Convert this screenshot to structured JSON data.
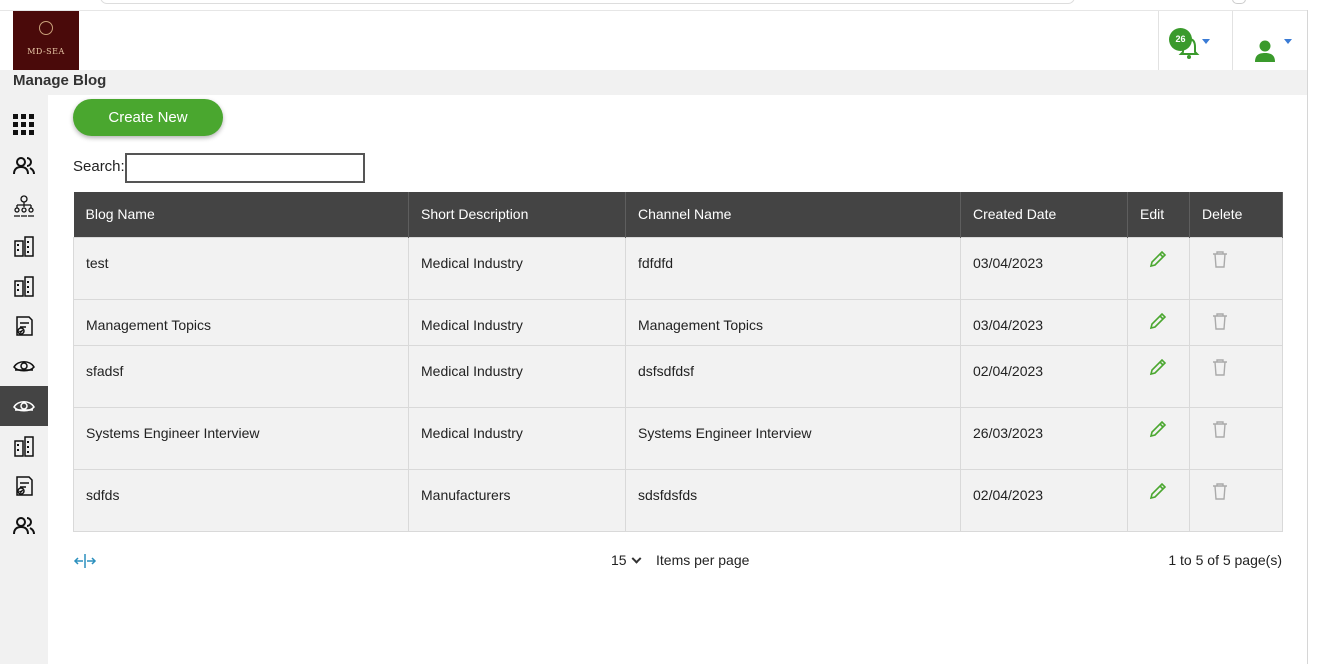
{
  "header": {
    "logo_text": "MD-SEA",
    "notification_count": "26"
  },
  "page": {
    "title": "Manage Blog"
  },
  "toolbar": {
    "create_label": "Create New"
  },
  "search": {
    "label": "Search:",
    "value": ""
  },
  "table": {
    "headers": [
      "Blog Name",
      "Short Description",
      "Channel Name",
      "Created Date",
      "Edit",
      "Delete"
    ],
    "rows": [
      {
        "blog_name": "test",
        "short_description": "Medical Industry",
        "channel_name": "fdfdfd",
        "created_date": "03/04/2023"
      },
      {
        "blog_name": "Management Topics",
        "short_description": "Medical Industry",
        "channel_name": "Management Topics",
        "created_date": "03/04/2023"
      },
      {
        "blog_name": "sfadsf",
        "short_description": "Medical Industry",
        "channel_name": "dsfsdfdsf",
        "created_date": "02/04/2023"
      },
      {
        "blog_name": "Systems Engineer Interview",
        "short_description": "Medical Industry",
        "channel_name": "Systems Engineer Interview",
        "created_date": "26/03/2023"
      },
      {
        "blog_name": "sdfds",
        "short_description": "Manufacturers",
        "channel_name": "sdsfdsfds",
        "created_date": "02/04/2023"
      }
    ]
  },
  "pagination": {
    "per_page_value": "15",
    "per_page_label": "Items per page",
    "range_text": "1 to 5 of 5 page(s)"
  },
  "sidebar": {
    "icons": [
      "apps-grid-icon",
      "users-icon",
      "org-chart-icon",
      "buildings-icon",
      "buildings-icon",
      "document-check-icon",
      "eye-icon",
      "eye-icon",
      "buildings-icon",
      "document-check-icon",
      "users-icon"
    ],
    "active_index": 7
  },
  "colors": {
    "accent_green": "#4aa72f",
    "header_dark": "#444444",
    "logo_bg": "#4a0a0a"
  }
}
